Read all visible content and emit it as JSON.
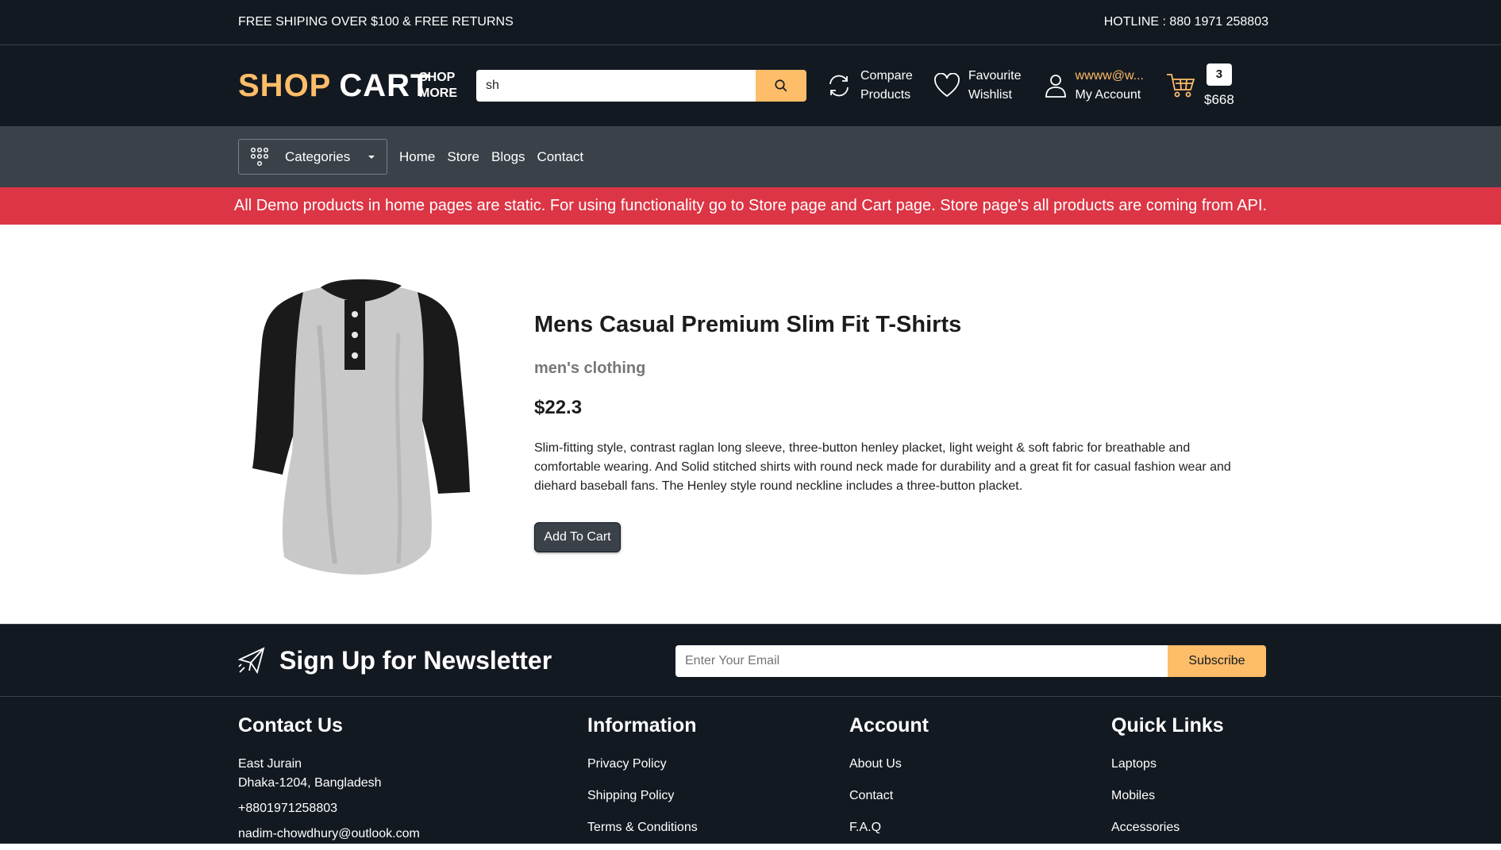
{
  "top_strip": {
    "left_text": "FREE SHIPING OVER $100 & FREE RETURNS",
    "right_text": "HOTLINE : 880 1971 258803"
  },
  "header": {
    "logo_part1": "SHOP",
    "logo_part2": "CART",
    "shop_more_line1": "SHOP",
    "shop_more_line2": "MORE",
    "search_value": "sh",
    "compare_line1": "Compare",
    "compare_line2": "Products",
    "wishlist_line1": "Favourite",
    "wishlist_line2": "Wishlist",
    "account_email": "wwww@w...",
    "account_label": "My Account",
    "cart_count": "3",
    "cart_total": "$668"
  },
  "nav": {
    "categories_label": "Categories",
    "links": [
      "Home",
      "Store",
      "Blogs",
      "Contact"
    ]
  },
  "banner": {
    "text": "All Demo products in home pages are static. For using functionality go to Store page and Cart page. Store page's all products are coming from API."
  },
  "product": {
    "title": "Mens Casual Premium Slim Fit T-Shirts",
    "category": "men's clothing",
    "price": "$22.3",
    "description": "Slim-fitting style, contrast raglan long sleeve, three-button henley placket, light weight & soft fabric for breathable and comfortable wearing. And Solid stitched shirts with round neck made for durability and a great fit for casual fashion wear and diehard baseball fans. The Henley style round neckline includes a three-button placket.",
    "add_to_cart_label": "Add To Cart"
  },
  "newsletter": {
    "title": "Sign Up for Newsletter",
    "email_placeholder": "Enter Your Email",
    "subscribe_label": "Subscribe"
  },
  "footer": {
    "contact": {
      "title": "Contact Us",
      "address_line1": "East Jurain",
      "address_line2": "Dhaka-1204, Bangladesh",
      "phone": "+8801971258803",
      "email": "nadim-chowdhury@outlook.com"
    },
    "information": {
      "title": "Information",
      "items": [
        "Privacy Policy",
        "Shipping Policy",
        "Terms & Conditions"
      ]
    },
    "account": {
      "title": "Account",
      "items": [
        "About Us",
        "Contact",
        "F.A.Q"
      ]
    },
    "quick_links": {
      "title": "Quick Links",
      "items": [
        "Laptops",
        "Mobiles",
        "Accessories"
      ]
    }
  },
  "colors": {
    "dark": "#131921",
    "nav": "#3b4149",
    "accent": "#febd69",
    "banner": "#dc3545"
  }
}
